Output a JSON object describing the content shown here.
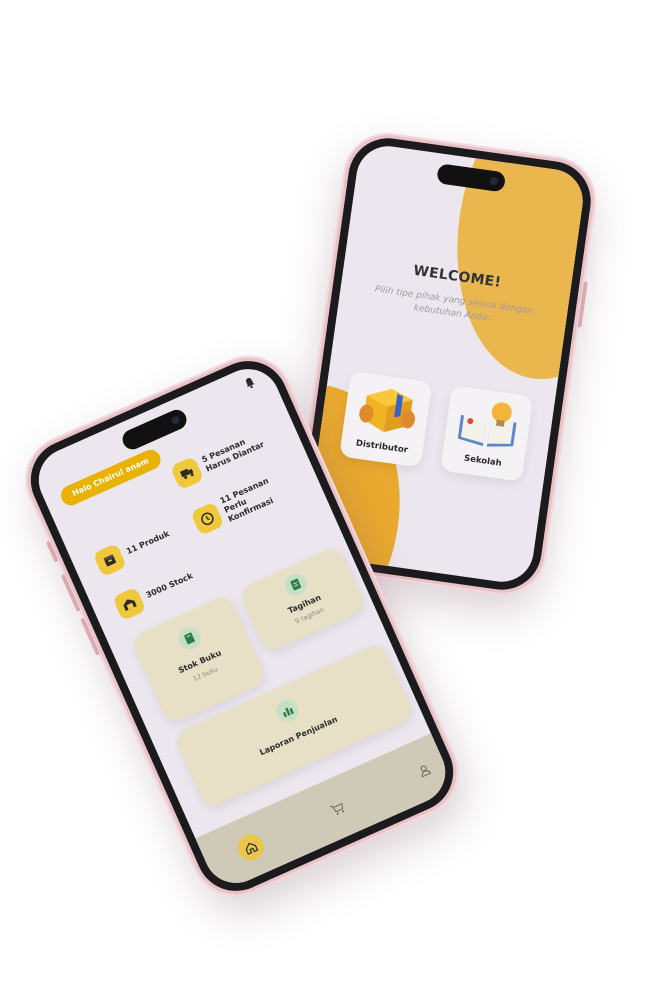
{
  "welcome_screen": {
    "title": "WELCOME!",
    "subtitle": "Pilih tipe pihak yang sesuai dengan kebutuhan Anda:",
    "roles": [
      {
        "label": "Distributor",
        "icon": "package-box-icon"
      },
      {
        "label": "Sekolah",
        "icon": "book-lightbulb-icon"
      }
    ],
    "colors": {
      "accent_top": "#eab64e",
      "accent_bottom": "#e9a92f",
      "background": "#ece6ee"
    }
  },
  "dashboard_screen": {
    "greeting": "Halo Chairul anam",
    "stats": [
      {
        "label": "5 Pesanan Harus Diantar",
        "icon": "truck-icon"
      },
      {
        "label": "11 Produk",
        "icon": "box-icon"
      },
      {
        "label": "11 Pesanan Perlu Konfirmasi",
        "icon": "clock-icon"
      },
      {
        "label": "3000 Stock",
        "icon": "warehouse-icon"
      }
    ],
    "tiles": [
      {
        "title": "Stok Buku",
        "subtitle": "12 buku",
        "icon": "book-icon"
      },
      {
        "title": "Tagihan",
        "subtitle": "9 tagihan",
        "icon": "document-icon"
      },
      {
        "title": "Laporan Penjualan",
        "icon": "bar-chart-icon"
      }
    ],
    "nav": [
      "home-icon",
      "cart-icon",
      "user-icon"
    ],
    "colors": {
      "accent": "#eab200",
      "tile": "#e7e0c6",
      "navbar": "#cfcab8"
    }
  }
}
